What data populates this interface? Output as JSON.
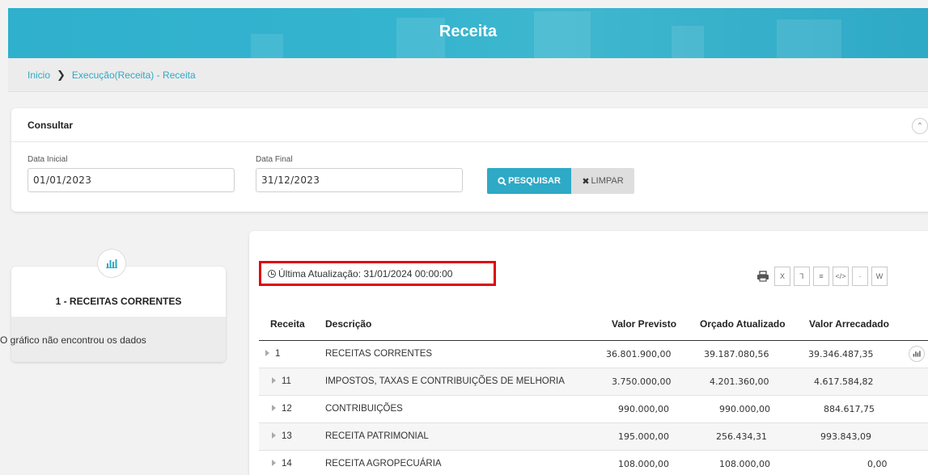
{
  "header": {
    "title": "Receita"
  },
  "breadcrumb": {
    "home": "Inicio",
    "current": "Execução(Receita) - Receita"
  },
  "consultar": {
    "title": "Consultar",
    "data_inicial_label": "Data Inicial",
    "data_inicial_value": "01/01/2023",
    "data_final_label": "Data Final",
    "data_final_value": "31/12/2023",
    "pesquisar_label": "PESQUISAR",
    "limpar_label": "LIMPAR"
  },
  "chart_card": {
    "title": "1 - RECEITAS CORRENTES",
    "message": "O gráfico não encontrou os dados"
  },
  "main": {
    "ultima_atualizacao": "Última Atualização: 31/01/2024 00:00:00",
    "export_icons": [
      "printer-icon",
      "excel-icon",
      "pdf-icon",
      "text-icon",
      "code-icon",
      "csv-icon",
      "word-icon"
    ],
    "columns": [
      "Receita",
      "Descrição",
      "Valor Previsto",
      "Orçado Atualizado",
      "Valor Arrecadado"
    ],
    "rows": [
      {
        "receita": "1",
        "descricao": "RECEITAS CORRENTES",
        "previsto": "36.801.900,00",
        "orcado": "39.187.080,56",
        "arrecadado": "39.346.487,35"
      },
      {
        "receita": "11",
        "descricao": "IMPOSTOS, TAXAS E CONTRIBUIÇÕES DE MELHORIA",
        "previsto": "3.750.000,00",
        "orcado": "4.201.360,00",
        "arrecadado": "4.617.584,82"
      },
      {
        "receita": "12",
        "descricao": "CONTRIBUIÇÕES",
        "previsto": "990.000,00",
        "orcado": "990.000,00",
        "arrecadado": "884.617,75"
      },
      {
        "receita": "13",
        "descricao": "RECEITA PATRIMONIAL",
        "previsto": "195.000,00",
        "orcado": "256.434,31",
        "arrecadado": "993.843,09"
      },
      {
        "receita": "14",
        "descricao": "RECEITA AGROPECUÁRIA",
        "previsto": "108.000,00",
        "orcado": "108.000,00",
        "arrecadado": "0,00"
      }
    ]
  },
  "colors": {
    "accent": "#2ea9c6",
    "highlight_border": "#e0001b"
  }
}
